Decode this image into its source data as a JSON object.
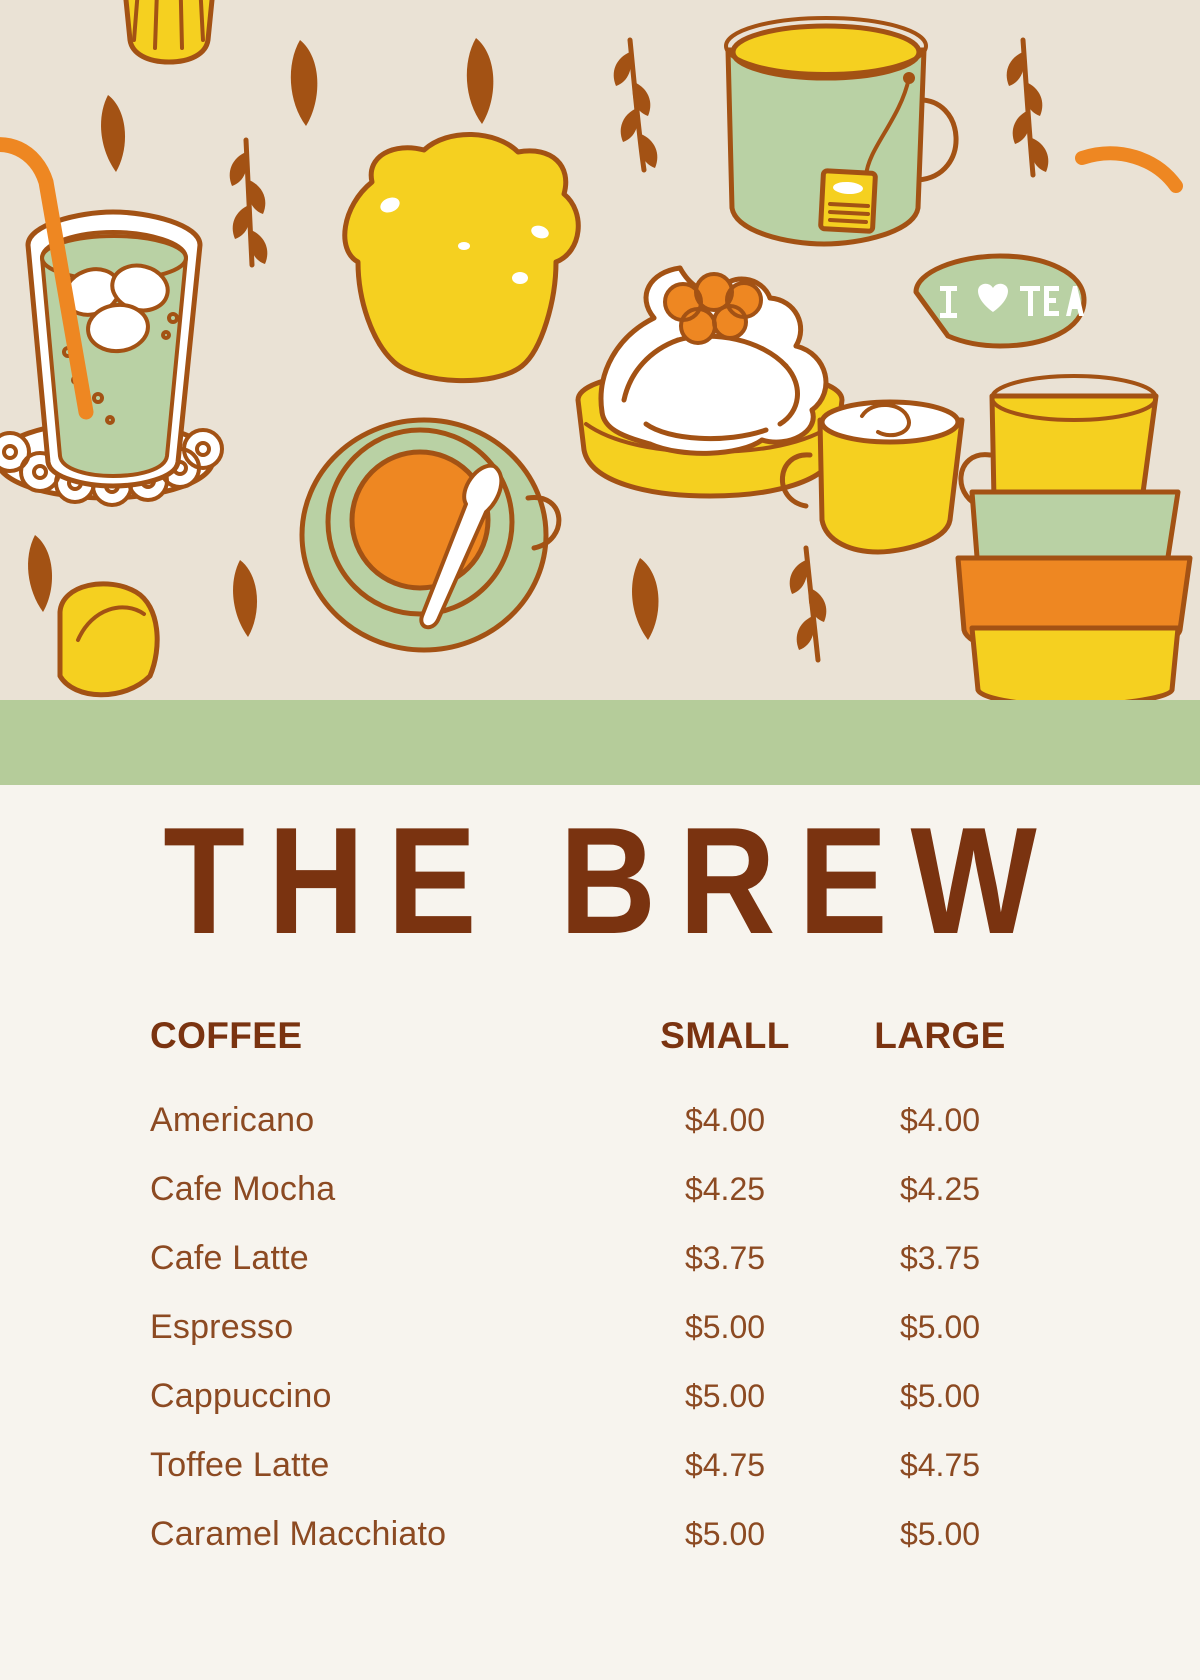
{
  "colors": {
    "pattern_bg": "#EAE2D5",
    "green_band": "#B5CC9A",
    "menu_bg": "#F7F4EE",
    "title_brown": "#7A3310",
    "text_brown": "#8C4A22",
    "outline_brown": "#A35214",
    "yellow": "#F5D020",
    "orange": "#EE8722",
    "mint_green": "#B9D1A4",
    "cream_white": "#FFFFFF"
  },
  "header_illustration": {
    "name": "cafe-pattern-illustration",
    "background": "#EAE2D5",
    "items": [
      {
        "name": "iced-matcha-drink-with-straw",
        "description": "tall green iced drink with orange straw, ice cubes and lace doily"
      },
      {
        "name": "toast-slice",
        "description": "yellow slice of toast"
      },
      {
        "name": "tea-mug-with-teabag",
        "description": "green mug filled with yellow tea and hanging tea bag"
      },
      {
        "name": "cream-tart",
        "description": "yellow tart with white whipped cream swirl topped with orange berries"
      },
      {
        "name": "coffee-cup-and-saucer",
        "description": "green cup and saucer with orange coffee and spoon"
      },
      {
        "name": "speech-bubble-i-love-tea",
        "description": "green speech bubble with white text"
      },
      {
        "name": "stacked-cups",
        "description": "stack of yellow, green, orange and yellow cups"
      },
      {
        "name": "cupcake",
        "description": "yellow cupcake at top left"
      },
      {
        "name": "leaves-and-sprigs",
        "description": "scattered brown leaves and wheat sprigs"
      }
    ],
    "speech_bubble_text": "I ♥ TEA"
  },
  "menu": {
    "title": "THE BREW",
    "columns": {
      "item": "COFFEE",
      "small": "SMALL",
      "large": "LARGE"
    },
    "rows": [
      {
        "item": "Americano",
        "small": "$4.00",
        "large": "$4.00"
      },
      {
        "item": "Cafe Mocha",
        "small": "$4.25",
        "large": "$4.25"
      },
      {
        "item": "Cafe Latte",
        "small": "$3.75",
        "large": "$3.75"
      },
      {
        "item": "Espresso",
        "small": "$5.00",
        "large": "$5.00"
      },
      {
        "item": "Cappuccino",
        "small": "$5.00",
        "large": "$5.00"
      },
      {
        "item": "Toffee Latte",
        "small": "$4.75",
        "large": "$4.75"
      },
      {
        "item": "Caramel Macchiato",
        "small": "$5.00",
        "large": "$5.00"
      }
    ]
  }
}
